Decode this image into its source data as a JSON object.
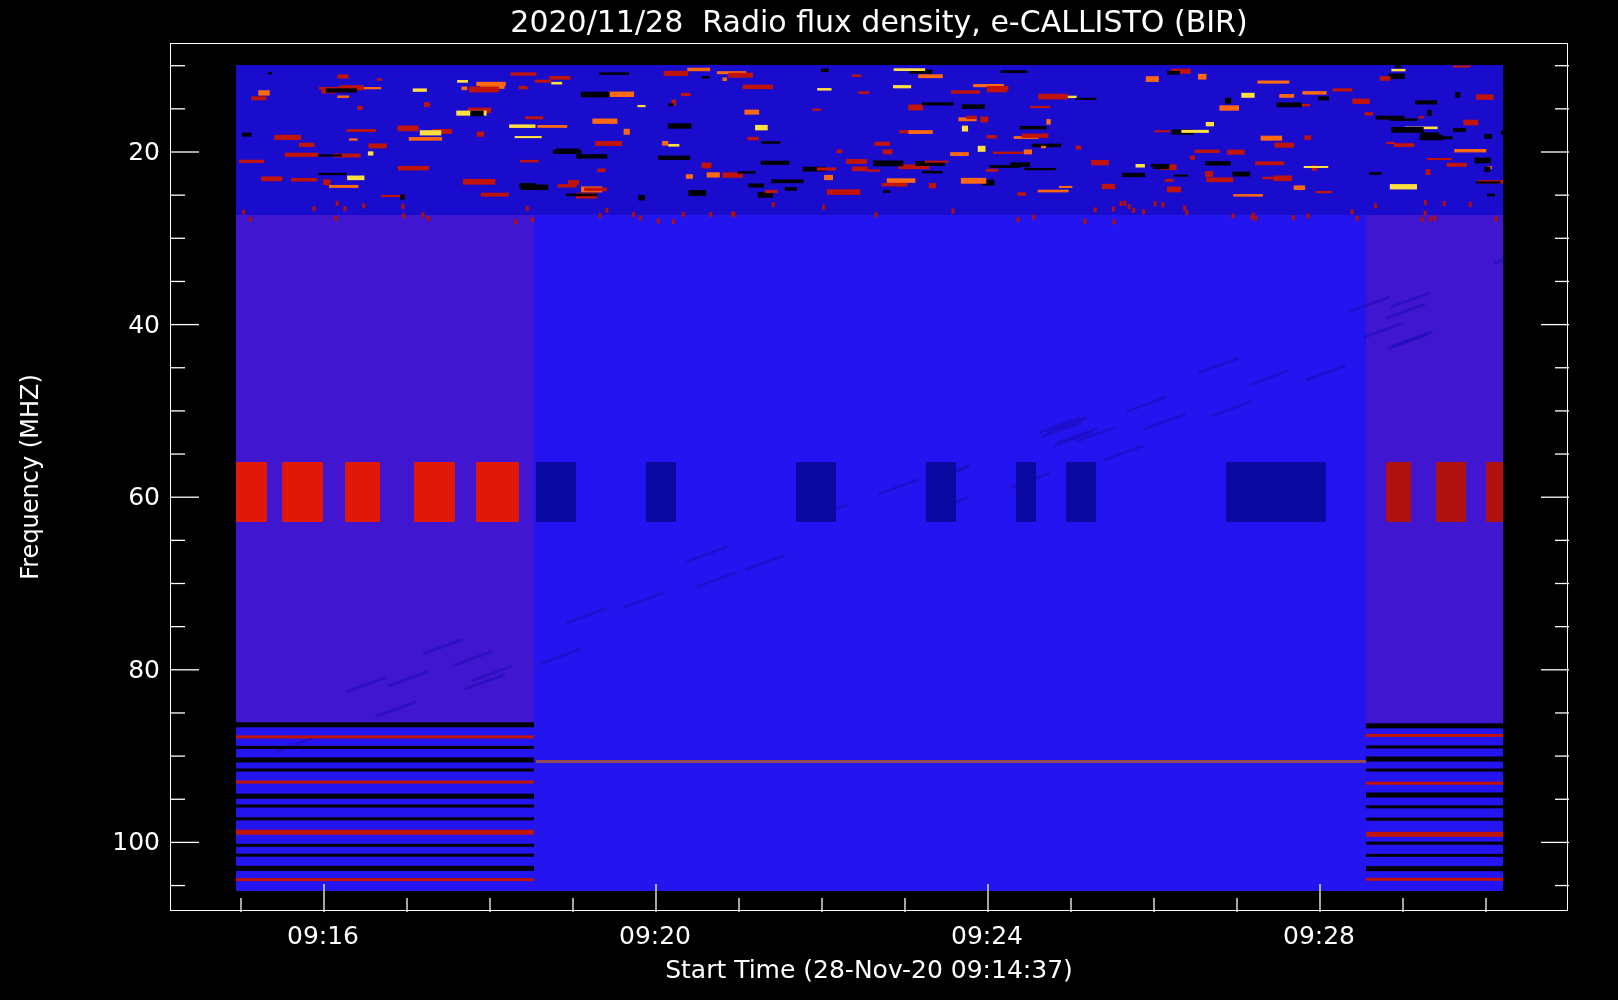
{
  "plot": {
    "title": "2020/11/28  Radio flux density, e-CALLISTO (BIR)",
    "ylabel": "Frequency (MHZ)",
    "xlabel": "Start Time (28-Nov-20 09:14:37)",
    "yticks": [
      "20",
      "40",
      "60",
      "80",
      "100"
    ],
    "xticks": [
      "09:16",
      "09:20",
      "09:24",
      "09:28"
    ]
  }
}
